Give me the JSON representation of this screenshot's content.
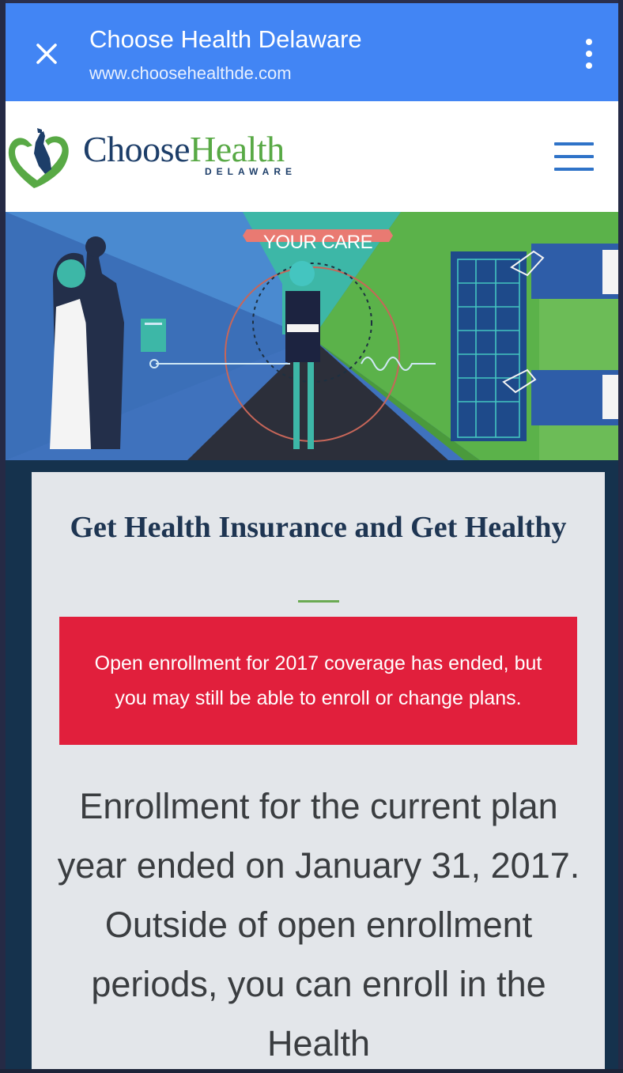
{
  "toolbar": {
    "title": "Choose Health Delaware",
    "url": "www.choosehealthde.com",
    "color": "#4285f4"
  },
  "logo": {
    "choose": "Choose",
    "health": "Health",
    "sub": "DELAWARE"
  },
  "hero": {
    "banner_text": "YOUR CARE"
  },
  "card": {
    "title": "Get Health Insurance and Get Healthy",
    "alert": "Open enrollment for 2017 coverage has ended, but you may still be able to enroll or change plans.",
    "body": "Enrollment for the current plan year ended on January 31, 2017. Outside of open enrollment periods, you can enroll in the Health"
  },
  "colors": {
    "alert": "#e11f3c",
    "brand_navy": "#1d3e69",
    "brand_green": "#58a945"
  }
}
